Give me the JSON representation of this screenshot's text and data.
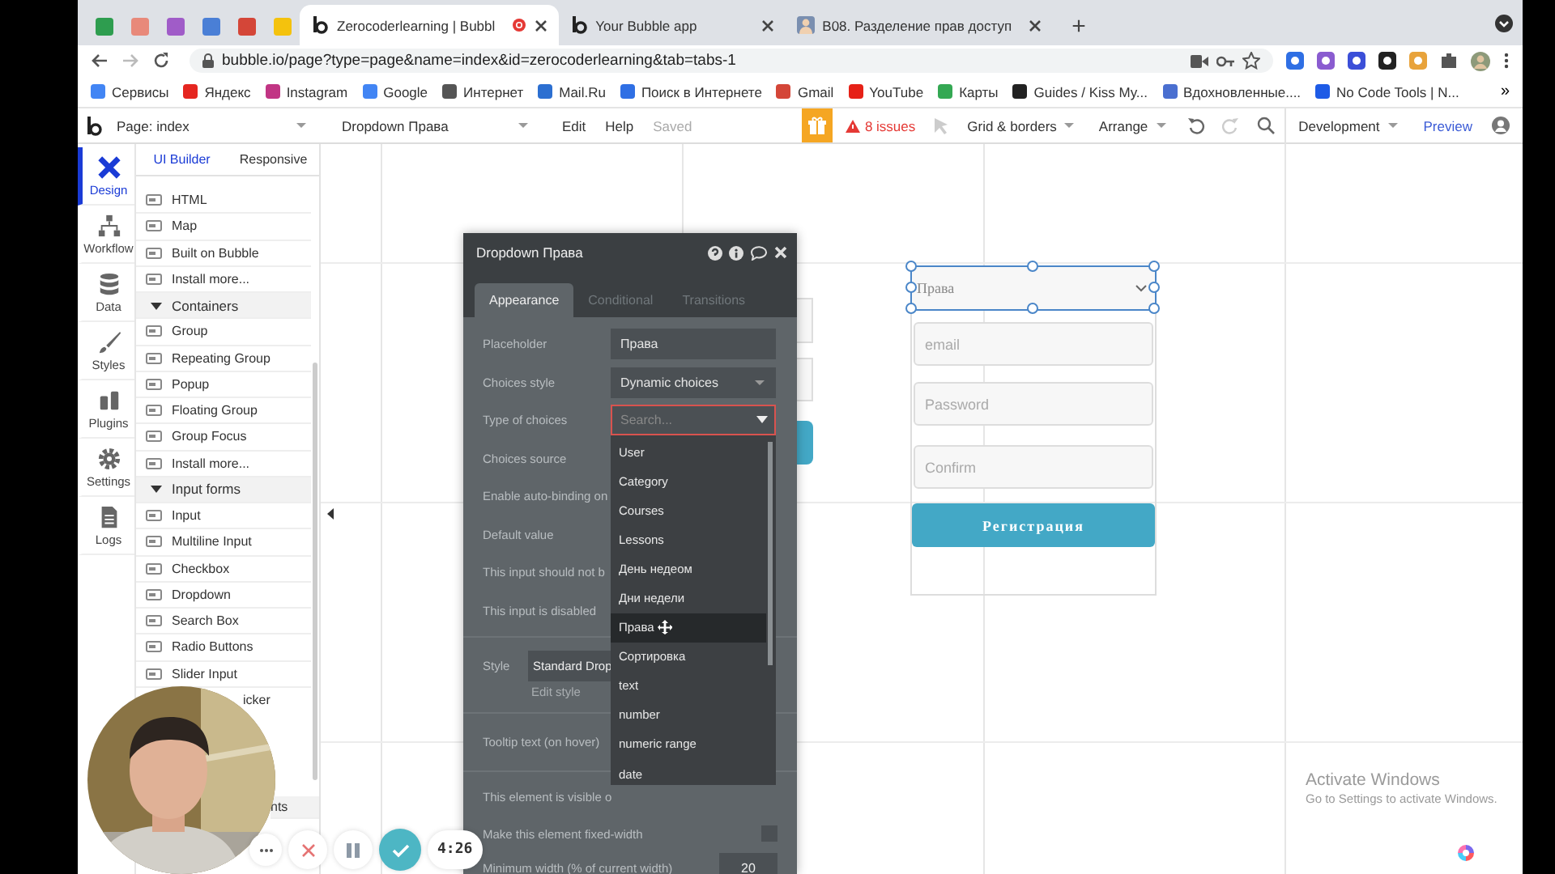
{
  "browser": {
    "pinned_tabs": [
      {
        "color": "#2e9d4f"
      },
      {
        "color": "#e8897a"
      },
      {
        "color": "#a05cc8"
      },
      {
        "color": "#4a7fd6"
      },
      {
        "color": "#d44638"
      },
      {
        "color": "#f4c20d"
      }
    ],
    "tabs": [
      {
        "title": "Zerocoderlearning | Bubbl",
        "selected": true
      },
      {
        "title": "Your Bubble app",
        "selected": false
      },
      {
        "title": "B08. Разделение прав доступ",
        "selected": false
      }
    ],
    "new_tab": "+",
    "address": "bubble.io/page?type=page&name=index&id=zerocoderlearning&tab=tabs-1",
    "bookmarks": [
      {
        "label": "Сервисы",
        "color": "#4285f4"
      },
      {
        "label": "Яндекс",
        "color": "#e52620"
      },
      {
        "label": "Instagram",
        "color": "#c13584"
      },
      {
        "label": "Google",
        "color": "#4285f4"
      },
      {
        "label": "Интернет",
        "color": "#555555"
      },
      {
        "label": "Mail.Ru",
        "color": "#2c6fd1"
      },
      {
        "label": "Поиск в Интернете",
        "color": "#2f6fe4"
      },
      {
        "label": "Gmail",
        "color": "#d44638"
      },
      {
        "label": "YouTube",
        "color": "#e62117"
      },
      {
        "label": "Карты",
        "color": "#34a853"
      },
      {
        "label": "Guides / Kiss My...",
        "color": "#222222"
      },
      {
        "label": "Вдохновленные....",
        "color": "#4a6fd0"
      },
      {
        "label": "No Code Tools | N...",
        "color": "#1e5be6"
      }
    ],
    "bookmarks_more": "»"
  },
  "toolbar": {
    "page": "Page: index",
    "element": "Dropdown Права",
    "menus": [
      "Edit",
      "Help"
    ],
    "save_status": "Saved",
    "issues": "8 issues",
    "grid": "Grid & borders",
    "arrange": "Arrange",
    "mode": "Development",
    "preview": "Preview"
  },
  "sidebar": {
    "items": [
      {
        "label": "Design",
        "selected": true
      },
      {
        "label": "Workflow",
        "selected": false
      },
      {
        "label": "Data",
        "selected": false
      },
      {
        "label": "Styles",
        "selected": false
      },
      {
        "label": "Plugins",
        "selected": false
      },
      {
        "label": "Settings",
        "selected": false
      },
      {
        "label": "Logs",
        "selected": false
      }
    ]
  },
  "palette": {
    "tabs": [
      {
        "label": "UI Builder",
        "selected": true
      },
      {
        "label": "Responsive",
        "selected": false
      }
    ],
    "items": [
      {
        "kind": "item",
        "label": "HTML"
      },
      {
        "kind": "item",
        "label": "Map"
      },
      {
        "kind": "item",
        "label": "Built on Bubble"
      },
      {
        "kind": "item",
        "label": "Install more..."
      },
      {
        "kind": "section",
        "label": "Containers",
        "expanded": true
      },
      {
        "kind": "item",
        "label": "Group"
      },
      {
        "kind": "item",
        "label": "Repeating Group"
      },
      {
        "kind": "item",
        "label": "Popup"
      },
      {
        "kind": "item",
        "label": "Floating Group"
      },
      {
        "kind": "item",
        "label": "Group Focus"
      },
      {
        "kind": "item",
        "label": "Install more..."
      },
      {
        "kind": "section",
        "label": "Input forms",
        "expanded": true
      },
      {
        "kind": "item",
        "label": "Input"
      },
      {
        "kind": "item",
        "label": "Multiline Input"
      },
      {
        "kind": "item",
        "label": "Checkbox"
      },
      {
        "kind": "item",
        "label": "Dropdown"
      },
      {
        "kind": "item",
        "label": "Search Box"
      },
      {
        "kind": "item",
        "label": "Radio Buttons"
      },
      {
        "kind": "item",
        "label": "Slider Input"
      },
      {
        "kind": "cut",
        "label": "icker"
      },
      {
        "kind": "cut-section",
        "label": "nts"
      }
    ]
  },
  "props": {
    "title": "Dropdown Права",
    "tabs": [
      {
        "label": "Appearance",
        "selected": true
      },
      {
        "label": "Conditional",
        "selected": false
      },
      {
        "label": "Transitions",
        "selected": false
      }
    ],
    "rows": [
      {
        "kind": "text",
        "label": "Placeholder",
        "value": "Права"
      },
      {
        "kind": "select",
        "label": "Choices style",
        "value": "Dynamic choices"
      },
      {
        "kind": "search",
        "label": "Type of choices",
        "placeholder": "Search...",
        "open": true
      },
      {
        "kind": "label",
        "label": "Choices source"
      },
      {
        "kind": "label",
        "label": "Enable auto-binding on"
      },
      {
        "kind": "label",
        "label": "Default value"
      },
      {
        "kind": "label",
        "label": "This input should not b"
      },
      {
        "kind": "label",
        "label": "This input is disabled"
      },
      {
        "kind": "style",
        "label": "Style",
        "value": "Standard Drop",
        "link": "Edit style"
      },
      {
        "kind": "tooltip",
        "label": "Tooltip text (on hover)"
      },
      {
        "kind": "label",
        "label": "This element is visible o"
      },
      {
        "kind": "checkbox",
        "label": "Make this element fixed-width",
        "checked": false
      },
      {
        "kind": "number",
        "label": "Minimum width (% of current width)",
        "value": "20"
      }
    ],
    "choices": [
      {
        "label": "User",
        "selected": false
      },
      {
        "label": "Category",
        "selected": false
      },
      {
        "label": "Courses",
        "selected": false
      },
      {
        "label": "Lessons",
        "selected": false
      },
      {
        "label": "День недеом",
        "selected": false
      },
      {
        "label": "Дни недели",
        "selected": false
      },
      {
        "label": "Права",
        "selected": true
      },
      {
        "label": "Сортировка",
        "selected": false
      },
      {
        "label": "text",
        "selected": false
      },
      {
        "label": "number",
        "selected": false
      },
      {
        "label": "numeric range",
        "selected": false
      },
      {
        "label": "date",
        "selected": false
      }
    ]
  },
  "canvas": {
    "form": {
      "dropdown": {
        "value": "Права",
        "selected": true
      },
      "fields": [
        {
          "placeholder": "email"
        },
        {
          "placeholder": "Password"
        },
        {
          "placeholder": "Confirm"
        }
      ],
      "button": "Регистрация"
    }
  },
  "recorder": {
    "timer": "4:26"
  },
  "activation": {
    "title": "Activate Windows",
    "hint": "Go to Settings to activate Windows."
  }
}
